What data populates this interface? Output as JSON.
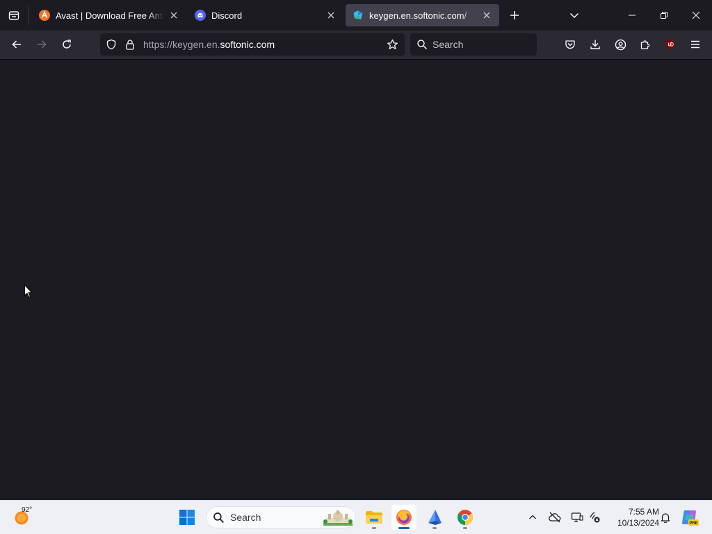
{
  "browser": {
    "tabs": [
      {
        "title": "Avast | Download Free Antivirus",
        "favicon": "avast-icon",
        "active": false
      },
      {
        "title": "Discord",
        "favicon": "discord-icon",
        "active": false
      },
      {
        "title": "keygen.en.softonic.com/",
        "favicon": "softonic-icon",
        "active": true
      }
    ],
    "address": {
      "prefix": "https://keygen.en.",
      "domain": "softonic.com"
    },
    "search_placeholder": "Search"
  },
  "taskbar": {
    "weather_temp": "92°",
    "search_placeholder": "Search",
    "time": "7:55 AM",
    "date": "10/13/2024",
    "apps": [
      "file-explorer",
      "firefox",
      "app-blue-sail",
      "chrome"
    ],
    "copilot_badge": "PRE"
  },
  "colors": {
    "chrome_bg": "#1c1b22",
    "toolbar_bg": "#2b2a33",
    "active_tab": "#42414d",
    "taskbar_bg": "#eef0f6",
    "accent": "#0067c0"
  }
}
